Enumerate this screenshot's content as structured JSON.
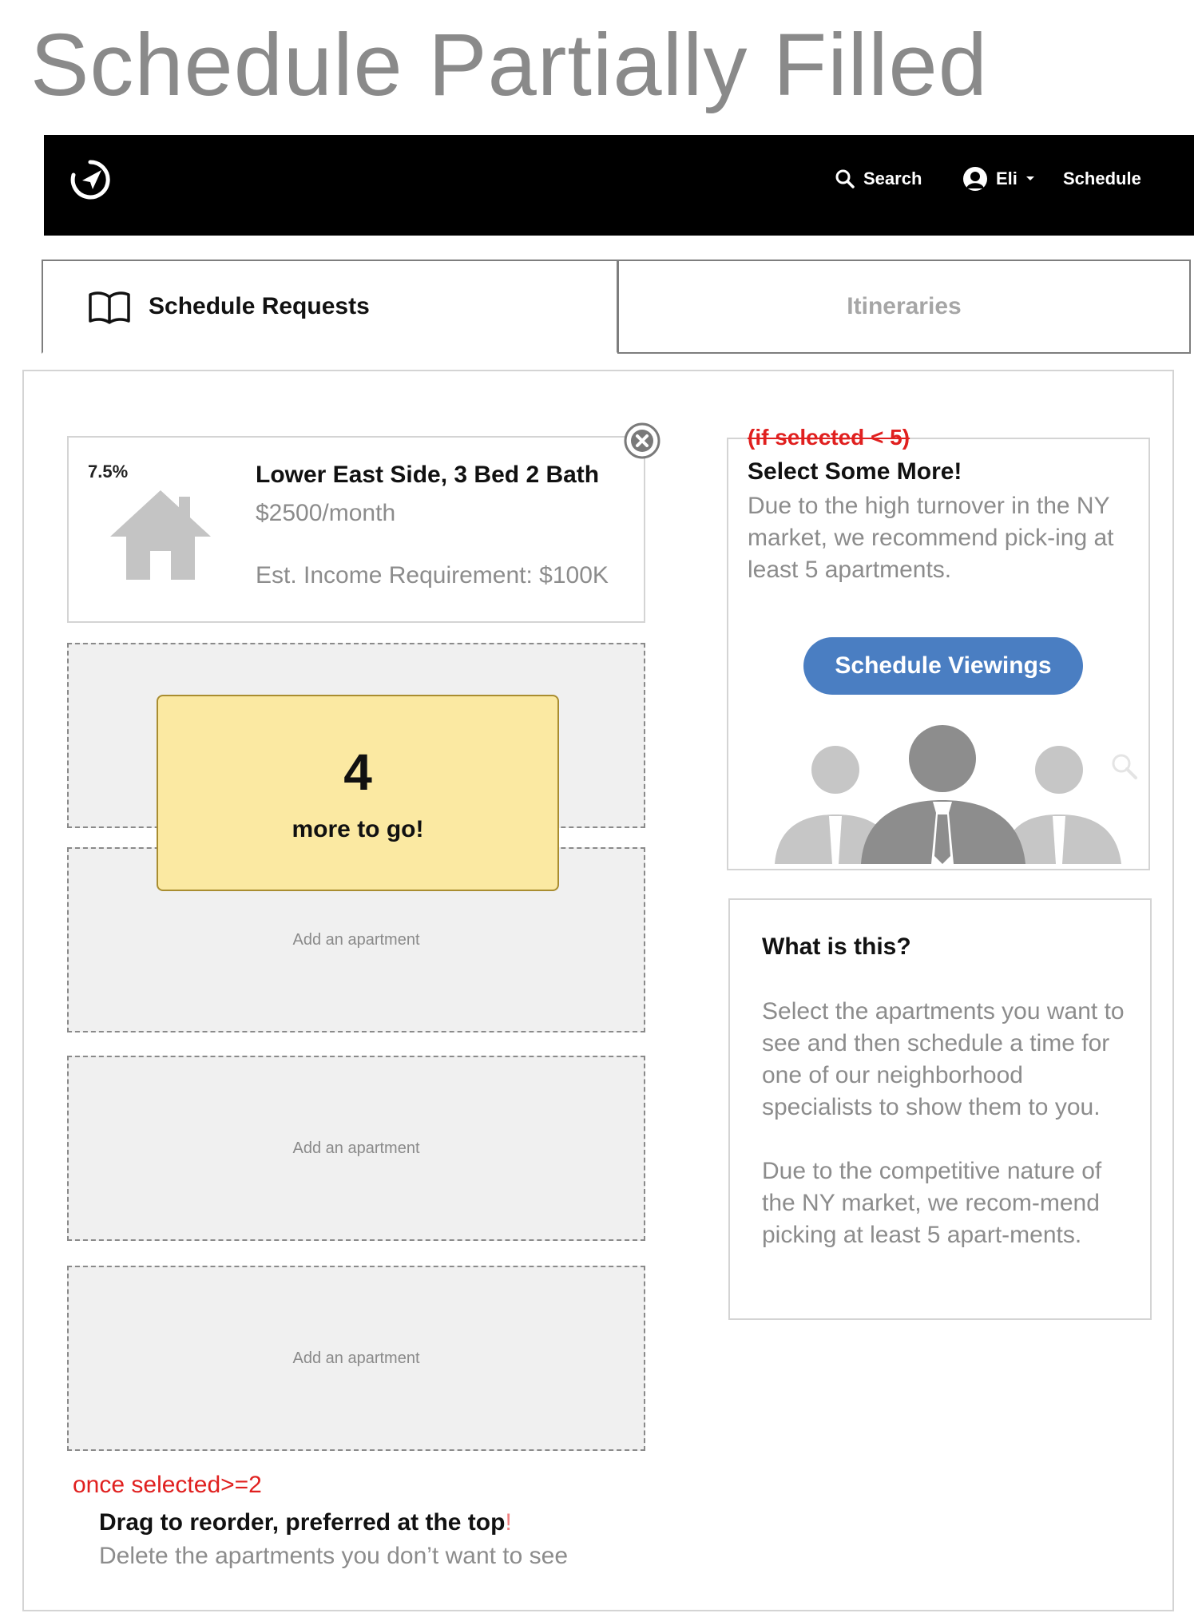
{
  "page": {
    "title": "Schedule Partially Filled"
  },
  "navbar": {
    "logo_icon": "compass-icon",
    "search_label": "Search",
    "user_name": "Eli",
    "schedule_label": "Schedule"
  },
  "tabs": [
    {
      "label": "Schedule Requests",
      "icon": "book-icon",
      "active": true
    },
    {
      "label": "Itineraries",
      "active": false
    }
  ],
  "apartment": {
    "percent": "7.5%",
    "name": "Lower East Side, 3 Bed 2 Bath",
    "price": "$2500/month",
    "income": "Est. Income Requirement: $100K"
  },
  "slots": [
    {
      "label": "Add an apartment"
    },
    {
      "label": "Add an apartment"
    },
    {
      "label": "Add an apartment"
    },
    {
      "label": "Add an apartment"
    }
  ],
  "progress": {
    "count": "4",
    "text": "more to go!"
  },
  "reorder_note": {
    "condition": "once selected>=2",
    "title": "Drag to reorder, preferred at the top",
    "title_suffix": "!",
    "subtitle": "Delete the apartments you don’t want to see"
  },
  "promo": {
    "condition": "(if selected < 5)",
    "title": "Select Some More!",
    "body": "Due to the high turnover in the NY market, we recommend pick-ing at least 5 apartments.",
    "cta_label": "Schedule Viewings"
  },
  "info": {
    "title": "What is this?",
    "paragraph1": "Select the apartments you want to see and then schedule a time for one of our neighborhood specialists to show them to you.",
    "paragraph2": "Due to the competitive nature of the NY market, we recom-mend picking at least 5 apart-ments."
  },
  "colors": {
    "navbar_bg": "#000000",
    "cta_bg": "#4a7ec2",
    "progress_bg": "#fbe9a2",
    "annotation_red": "#e0201f"
  }
}
